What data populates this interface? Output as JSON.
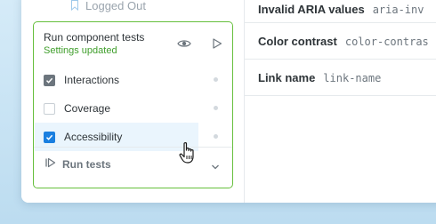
{
  "sidebar": {
    "logged_out_label": "Logged Out"
  },
  "panel": {
    "title": "Run component tests",
    "status": "Settings updated",
    "status_color": "#3f9e2b",
    "border_color": "#66bf3c",
    "items": [
      {
        "label": "Interactions",
        "checked": true,
        "icon": "checkbox-checked-icon"
      },
      {
        "label": "Coverage",
        "checked": false,
        "icon": "checkbox-empty-icon"
      },
      {
        "label": "Accessibility",
        "checked": true,
        "icon": "checkbox-checked-icon"
      }
    ],
    "run_label": "Run tests",
    "icons": [
      "eye-icon",
      "play-icon",
      "chevron-down-icon",
      "run-tests-icon"
    ]
  },
  "rules": [
    {
      "name": "Invalid ARIA values",
      "code": "aria-inv"
    },
    {
      "name": "Color contrast",
      "code": "color-contras"
    },
    {
      "name": "Link name",
      "code": "link-name"
    }
  ]
}
